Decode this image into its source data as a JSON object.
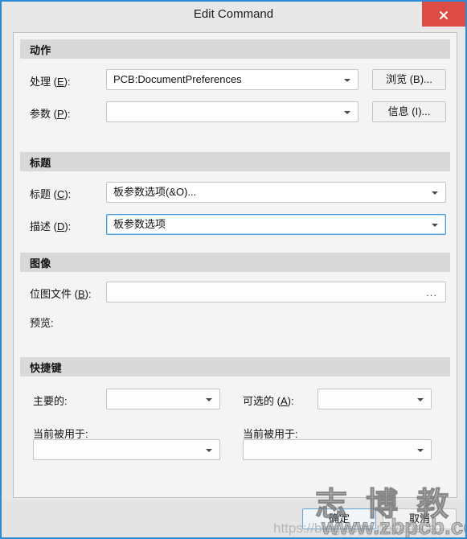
{
  "window": {
    "title": "Edit Command",
    "close_icon": "close-icon"
  },
  "groups": {
    "action": {
      "header": "动作",
      "process_label": "处理 (E):",
      "process_value": "PCB:DocumentPreferences",
      "parameters_label": "参数 (P):",
      "parameters_value": "",
      "browse_button": "浏览 (B)...",
      "info_button": "信息 (I)..."
    },
    "caption": {
      "header": "标题",
      "caption_label": "标题 (C):",
      "caption_value": "板参数选项(&O)...",
      "description_label": "描述 (D):",
      "description_value": "板参数选项"
    },
    "image": {
      "header": "图像",
      "bitmap_label": "位图文件 (B):",
      "bitmap_value": "",
      "bitmap_browse": "...",
      "preview_label": "预览:"
    },
    "shortcuts": {
      "header": "快捷键",
      "primary_label": "主要的:",
      "primary_value": "",
      "alternative_label": "可选的 (A):",
      "alternative_value": "",
      "primary_used_label": "当前被用于:",
      "primary_used_value": "",
      "alternative_used_label": "当前被用于:",
      "alternative_used_value": ""
    }
  },
  "footer": {
    "ok_button": "确定",
    "cancel_button": "取消"
  },
  "watermark": {
    "brand": "志 博 教 育",
    "url": "www.zbpcb.com",
    "faint_url": "https://blog.csdn.net/zbpcb"
  }
}
